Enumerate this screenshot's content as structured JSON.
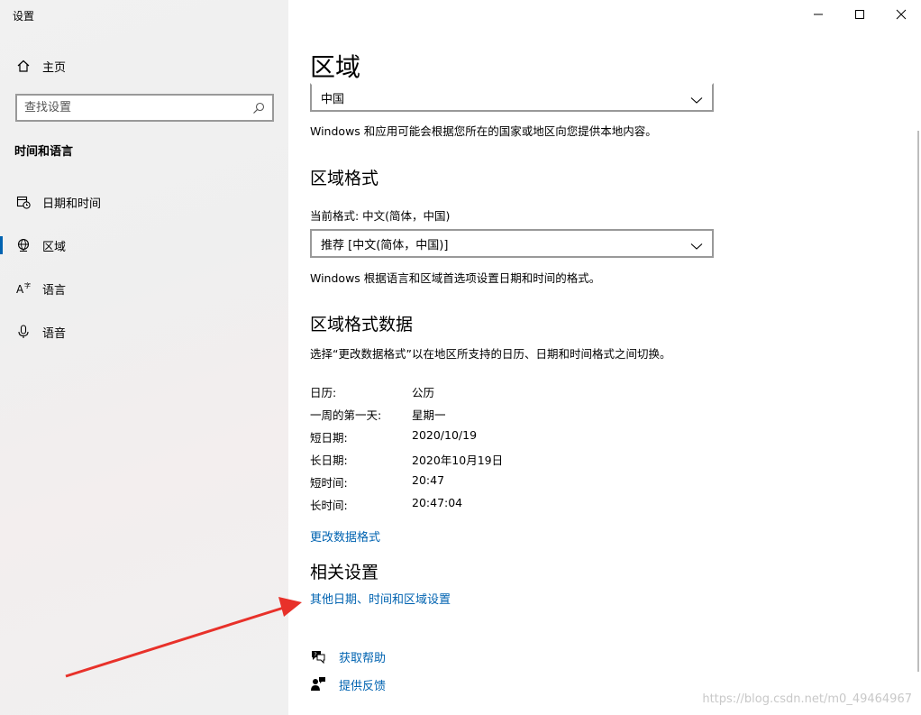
{
  "window": {
    "title": "设置",
    "minimize_icon": "minimize-icon",
    "maximize_icon": "maximize-icon",
    "close_icon": "close-icon"
  },
  "sidebar": {
    "home_label": "主页",
    "search_placeholder": "查找设置",
    "section_title": "时间和语言",
    "items": [
      {
        "label": "日期和时间",
        "icon": "calendar-clock-icon",
        "active": false
      },
      {
        "label": "区域",
        "icon": "globe-icon",
        "active": true
      },
      {
        "label": "语言",
        "icon": "language-icon",
        "active": false
      },
      {
        "label": "语音",
        "icon": "microphone-icon",
        "active": false
      }
    ]
  },
  "main": {
    "title": "区域",
    "country_value": "中国",
    "country_desc": "Windows 和应用可能会根据您所在的国家或地区向您提供本地内容。",
    "format_heading": "区域格式",
    "current_format_label": "当前格式: 中文(简体，中国)",
    "format_value": "推荐 [中文(简体，中国)]",
    "format_desc": "Windows 根据语言和区域首选项设置日期和时间的格式。",
    "data_heading": "区域格式数据",
    "data_desc": "选择“更改数据格式”以在地区所支持的日历、日期和时间格式之间切换。",
    "data_rows": [
      {
        "key": "日历:",
        "value": "公历"
      },
      {
        "key": "一周的第一天:",
        "value": "星期一"
      },
      {
        "key": "短日期:",
        "value": "2020/10/19"
      },
      {
        "key": "长日期:",
        "value": "2020年10月19日"
      },
      {
        "key": "短时间:",
        "value": "20:47"
      },
      {
        "key": "长时间:",
        "value": "20:47:04"
      }
    ],
    "change_format_link": "更改数据格式",
    "related_heading": "相关设置",
    "related_link": "其他日期、时间和区域设置",
    "help_label": "获取帮助",
    "feedback_label": "提供反馈"
  },
  "watermark": "https://blog.csdn.net/m0_49464967",
  "colors": {
    "accent": "#0063b1",
    "annotation_arrow": "#e8312a"
  }
}
